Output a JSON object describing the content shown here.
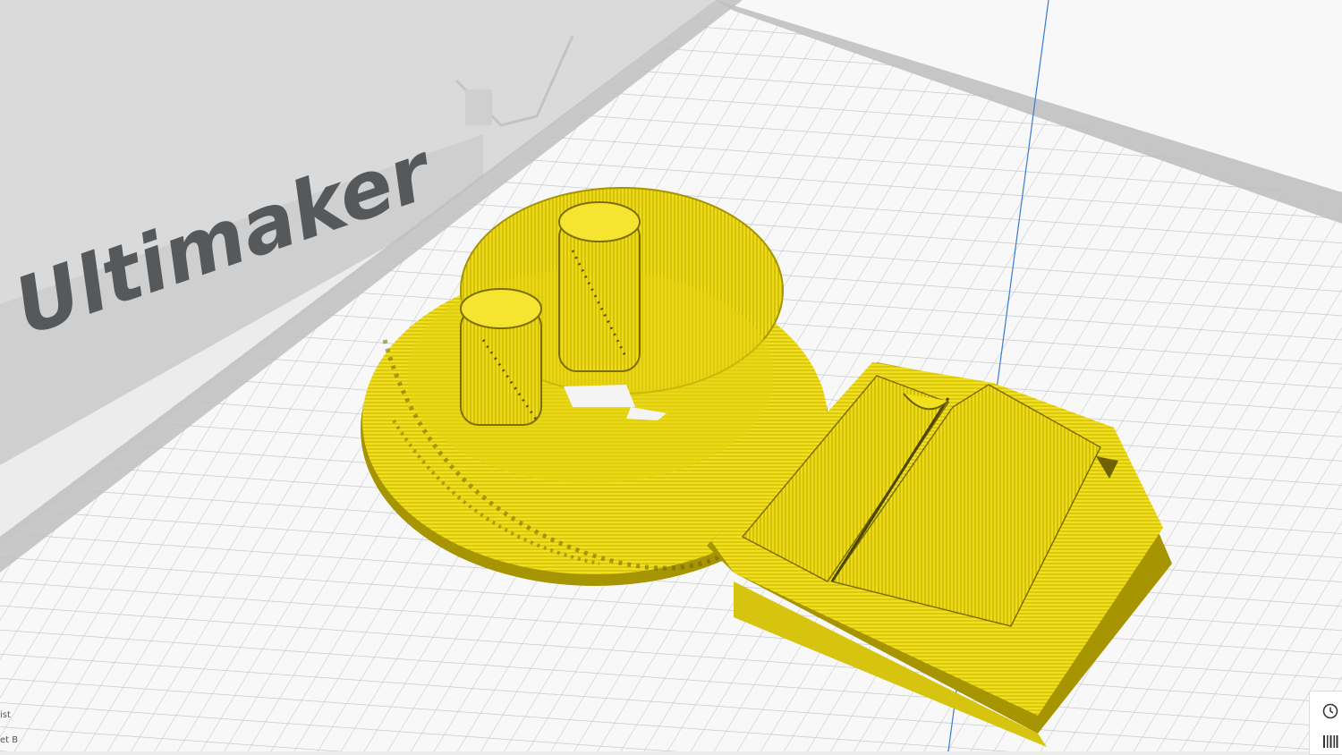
{
  "viewport": {
    "brand_text": "Ultimaker",
    "background_color": "#ececec",
    "plate_color": "#f8f8f8",
    "grid_color": "#c2c4c8",
    "model_color": "#f2e01c",
    "model_edge_color": "#a69400",
    "axis_line_color": "#3a7bd5"
  },
  "side_labels": {
    "top": "ist",
    "bottom": "et B"
  },
  "corner_panel": {
    "icons": [
      "clock-icon",
      "print-estimate-icon"
    ]
  }
}
